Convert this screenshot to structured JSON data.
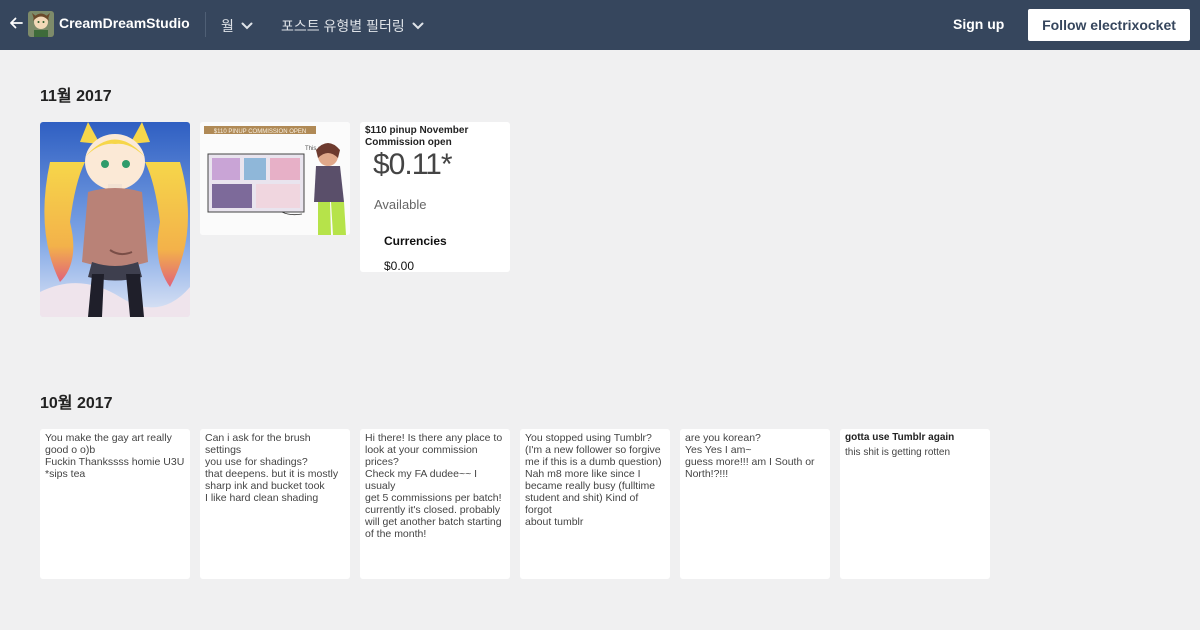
{
  "header": {
    "blog_name": "CreamDreamStudio",
    "month_filter_label": "월",
    "type_filter_label": "포스트 유형별 필터링",
    "signup_label": "Sign up",
    "follow_label": "Follow electrixocket",
    "icons": [
      "arrow-left-icon",
      "chevron-down-icon"
    ],
    "colors": {
      "bar": "#36465d",
      "follow_bg": "#ffffff",
      "follow_text": "#36465d"
    }
  },
  "sections": [
    {
      "month": "11월 2017",
      "tiles": [
        {
          "kind": "image",
          "description_icon": "pinup-illustration"
        },
        {
          "kind": "image",
          "banner_text": "$110 PINUP COMMISSION OPEN",
          "handwriting": "This guy"
        },
        {
          "kind": "text",
          "title": "$110 pinup November Commission open",
          "price": "$0.11*",
          "availability": "Available",
          "currencies_label": "Currencies",
          "currency_value": "$0.00"
        }
      ]
    },
    {
      "month": "10월 2017",
      "asks": [
        {
          "text": "You make the gay art really\ngood o o)b\nFuckin Thankssss homie U3U\n*sips tea"
        },
        {
          "text": "Can i ask for the brush settings\nyou use for shadings?\nthat deepens. but it is mostly\nsharp ink and bucket took\nI like hard clean shading"
        },
        {
          "text": "Hi there! Is there any place to\nlook at your commission\nprices?\nCheck my FA dudee~~ I usualy\nget 5 commissions per batch!\ncurrently it's closed. probably\nwill get another batch starting\nof the month!"
        },
        {
          "text": "You stopped using Tumblr?\n(I'm a new follower so forgive\nme if this is a dumb question)\nNah m8 more like since I\nbecame really busy (fulltime\nstudent and shit) Kind of forgot\nabout tumblr"
        },
        {
          "text": "are you korean?\nYes Yes I am~\nguess more!!! am I South or\nNorth!?!!!"
        },
        {
          "title": "gotta use Tumblr again",
          "text": "this shit is getting rotten"
        }
      ]
    }
  ]
}
